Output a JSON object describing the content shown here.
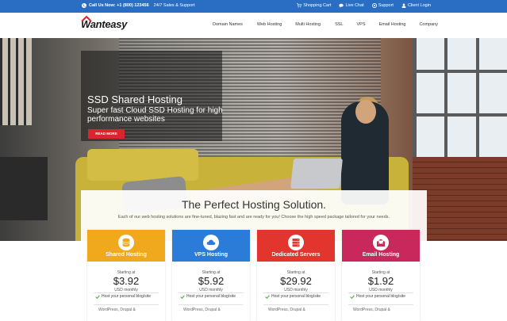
{
  "topbar": {
    "phone": "Call Us Now: +1 (800) 123456",
    "support_hours": "24/7 Sales & Support",
    "links": [
      {
        "label": "Shopping Cart",
        "icon": "cart-icon"
      },
      {
        "label": "Live Chat",
        "icon": "chat-icon"
      },
      {
        "label": "Support",
        "icon": "support-icon"
      },
      {
        "label": "Client Login",
        "icon": "user-icon"
      }
    ]
  },
  "header": {
    "logo": "Wanteasy",
    "nav": [
      "Domain Names",
      "Web Hosting",
      "Multi Hosting",
      "SSL",
      "VPS",
      "Email Hosting",
      "Company"
    ]
  },
  "hero": {
    "title": "SSD Shared Hosting",
    "subtitle": "Super fast Cloud SSD Hosting for high performance websites",
    "button": "READ MORE"
  },
  "solutions": {
    "title": "The Perfect Hosting Solution.",
    "subtitle": "Each of our web hosting solutions are fine-tuned, blazing fast and are ready for you! Choose the high speed package tailored for your needs."
  },
  "plans": [
    {
      "name": "Shared Hosting",
      "start": "Starting at",
      "price": "$3.92",
      "period": "USD monthly",
      "feature": "Host your personal blog/site",
      "feature2": "WordPress, Drupal &",
      "color": "#f0a91c",
      "icon": "database-icon"
    },
    {
      "name": "VPS Hosting",
      "start": "Starting at",
      "price": "$5.92",
      "period": "USD monthly",
      "feature": "Host your personal blog/site",
      "feature2": "WordPress, Drupal &",
      "color": "#2a7cd8",
      "icon": "cloud-icon"
    },
    {
      "name": "Dedicated Servers",
      "start": "Starting at",
      "price": "$29.92",
      "period": "USD monthly",
      "feature": "Host your personal blog/site",
      "feature2": "WordPress, Drupal &",
      "color": "#e2352d",
      "icon": "server-icon"
    },
    {
      "name": "Email Hosting",
      "start": "Starting at",
      "price": "$1.92",
      "period": "USD monthly",
      "feature": "Host your personal blog/site",
      "feature2": "WordPress, Drupal &",
      "color": "#c8285c",
      "icon": "email-icon"
    }
  ],
  "colors": {
    "topbar": "#2a6ec4",
    "accent_red": "#d7262e",
    "check_green": "#59b84a"
  }
}
